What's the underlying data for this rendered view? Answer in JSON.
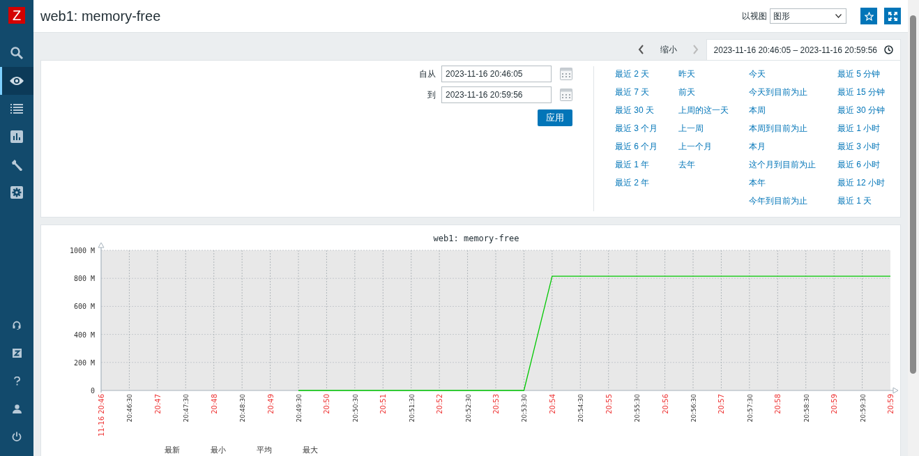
{
  "sidebar": {
    "logo": "Z",
    "items": [
      {
        "kind": "search",
        "selected": false
      },
      {
        "kind": "eye",
        "selected": true
      },
      {
        "kind": "list",
        "selected": false
      },
      {
        "kind": "chart",
        "selected": false
      },
      {
        "kind": "wrench",
        "selected": false
      },
      {
        "kind": "gear",
        "selected": false
      }
    ],
    "bottom_items": [
      {
        "kind": "headset"
      },
      {
        "kind": "share"
      },
      {
        "kind": "help"
      },
      {
        "kind": "user"
      },
      {
        "kind": "power"
      }
    ]
  },
  "header": {
    "title": "web1: memory-free",
    "view_label": "以视图",
    "view_select": "图形"
  },
  "time_nav": {
    "zoom_out": "缩小",
    "range_tab": {
      "label": "2023-11-16 20:46:05 – 2023-11-16 20:59:56",
      "selected": true
    }
  },
  "filter": {
    "from_label": "自从",
    "from": "2023-11-16 20:46:05",
    "to_label": "到",
    "to": "2023-11-16 20:59:56",
    "apply": "应用",
    "quick_ranges": [
      [
        "最近 2 天",
        "最近 7 天",
        "最近 30 天",
        "最近 3 个月",
        "最近 6 个月",
        "最近 1 年",
        "最近 2 年"
      ],
      [
        "昨天",
        "前天",
        "上周的这一天",
        "上一周",
        "上一个月",
        "去年"
      ],
      [
        "今天",
        "今天到目前为止",
        "本周",
        "本周到目前为止",
        "本月",
        "这个月到目前为止",
        "本年",
        "今年到目前为止"
      ],
      [
        "最近 5 分钟",
        "最近 15 分钟",
        "最近 30 分钟",
        "最近 1 小时",
        "最近 3 小时",
        "最近 6 小时",
        "最近 12 小时",
        "最近 1 天"
      ]
    ]
  },
  "graph": {
    "chart_data": {
      "type": "line",
      "title": "web1: memory-free",
      "categories": [
        "11-16 20:46",
        "20:46:30",
        "20:47",
        "20:47:30",
        "20:48",
        "20:48:30",
        "20:49",
        "20:49:30",
        "20:50",
        "20:50:30",
        "20:51",
        "20:51:30",
        "20:52",
        "20:52:30",
        "20:53",
        "20:53:30",
        "20:54",
        "20:54:30",
        "20:55",
        "20:55:30",
        "20:56",
        "20:56:30",
        "20:57",
        "20:57:30",
        "20:58",
        "20:58:30",
        "20:59",
        "20:59:30",
        "20:59"
      ],
      "series": [
        {
          "color": "#00c800",
          "values": [
            null,
            null,
            null,
            null,
            null,
            null,
            null,
            0,
            0,
            0,
            0,
            0,
            0,
            0,
            0,
            0,
            815,
            815,
            815,
            815,
            815,
            815,
            815,
            815,
            815,
            815,
            815,
            815,
            815
          ]
        }
      ],
      "ylim": [
        0,
        1000
      ],
      "grid": true,
      "yticks": [
        {
          "value": 0,
          "label": "0"
        },
        {
          "value": 200,
          "label": "200 M"
        },
        {
          "value": 400,
          "label": "400 M"
        },
        {
          "value": 600,
          "label": "600 M"
        },
        {
          "value": 800,
          "label": "800 M"
        },
        {
          "value": 1000,
          "label": "1000 M"
        }
      ]
    },
    "legend_columns": [
      "最新",
      "最小",
      "平均",
      "最大"
    ]
  }
}
